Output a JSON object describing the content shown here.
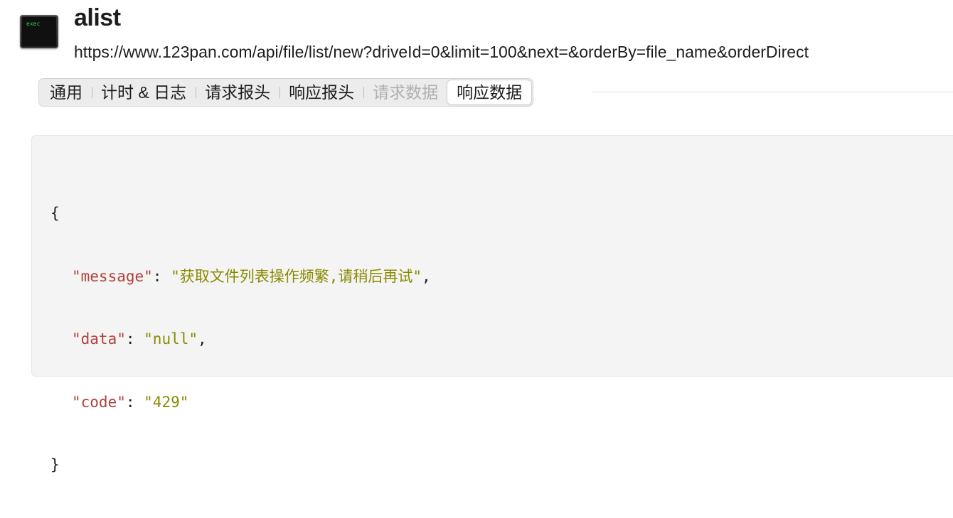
{
  "app": {
    "icon_label": "exec",
    "title": "alist",
    "url": "https://www.123pan.com/api/file/list/new?driveId=0&limit=100&next=&orderBy=file_name&orderDirect"
  },
  "tabs": [
    {
      "label": "通用",
      "state": "normal"
    },
    {
      "label": "计时 & 日志",
      "state": "normal"
    },
    {
      "label": "请求报头",
      "state": "normal"
    },
    {
      "label": "响应报头",
      "state": "normal"
    },
    {
      "label": "请求数据",
      "state": "disabled"
    },
    {
      "label": "响应数据",
      "state": "selected"
    }
  ],
  "response": {
    "open_brace": "{",
    "close_brace": "}",
    "fields": [
      {
        "key": "\"message\"",
        "value": "\"获取文件列表操作频繁,请稍后再试\"",
        "trailing": ","
      },
      {
        "key": "\"data\"",
        "value": "\"null\"",
        "trailing": ","
      },
      {
        "key": "\"code\"",
        "value": "\"429\"",
        "trailing": ""
      }
    ],
    "separator": ": "
  },
  "colors": {
    "json_key": "#b2403a",
    "json_string": "#8a8a00",
    "panel_bg": "#f4f4f4",
    "selected_tab_bg": "#ffffff"
  }
}
